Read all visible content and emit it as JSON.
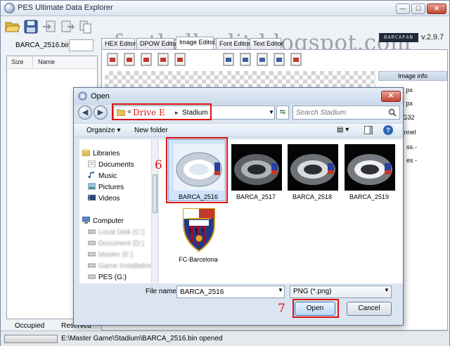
{
  "app": {
    "title": "PES Ultimate Data Explorer",
    "watermark": "football-edit.blogspot.com",
    "brand_badge": "BARCAFAN",
    "version": "v.2.9.7",
    "file_label": "BARCA_2516.bin",
    "file_list": {
      "col_size": "Size",
      "col_name": "Name"
    },
    "occupied": "Occupied",
    "reserved": "Reserved",
    "status": "E:\\Master Game\\Stadium\\BARCA_2516.bin opened",
    "tabs": [
      "HEX Editor",
      "DPOW Editor",
      "Image Editor",
      "Font Editor",
      "Text Editor"
    ],
    "active_tab": "Image Editor",
    "info_panel": {
      "header": "Image info",
      "width": "512 px",
      "height": "512 px",
      "format": "PNG32",
      "alpha": "channel",
      "row5_label": "ss.",
      "row5_value": "-",
      "row6_label": "es",
      "row6_value": "-"
    }
  },
  "dialog": {
    "title": "Open",
    "address": {
      "chevron": "«",
      "drive": "Drive E",
      "separator": "▸",
      "folder": "Stadium"
    },
    "search_placeholder": "Search Stadium",
    "organize": "Organize ▾",
    "new_folder": "New folder",
    "view_label": "▤ ▾",
    "help": "?",
    "nav": {
      "libraries": "Libraries",
      "documents": "Documents",
      "music": "Music",
      "pictures": "Pictures",
      "videos": "Videos",
      "computer": "Computer",
      "local_disk": "Local Disk (C:)",
      "document_d": "Document (D:)",
      "master_e": "Master (E:)",
      "game_install": "Game Installation",
      "pes_g": "PES (G:)"
    },
    "files": [
      {
        "name": "BARCA_2516",
        "selected": true
      },
      {
        "name": "BARCA_2517",
        "selected": false
      },
      {
        "name": "BARCA_2518",
        "selected": false
      },
      {
        "name": "BARCA_2519",
        "selected": false
      },
      {
        "name": "FC-Barcelona",
        "selected": false
      }
    ],
    "filename_label": "File name:",
    "filename_value": "BARCA_2516",
    "filetype": "PNG (*.png)",
    "open_label": "Open",
    "cancel_label": "Cancel",
    "step_6": "6",
    "step_7": "7",
    "colors": {
      "annotation": "#dd1111",
      "selection": "#cfe3fb"
    }
  }
}
